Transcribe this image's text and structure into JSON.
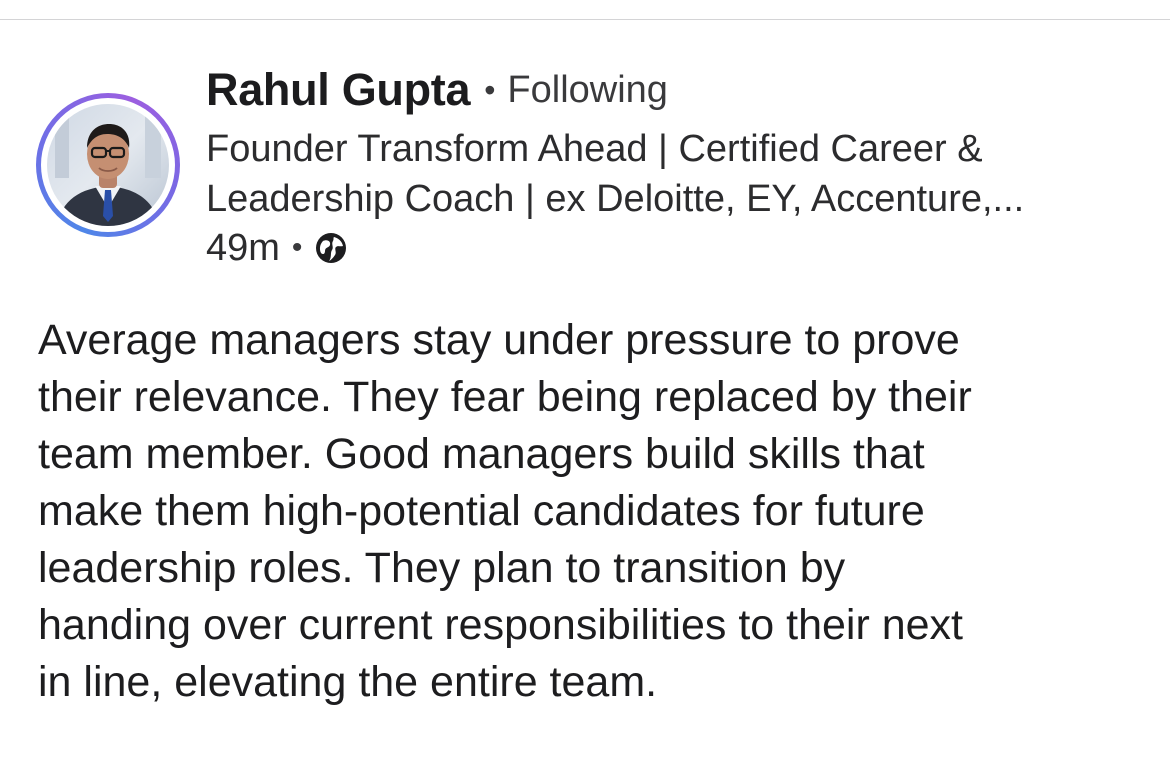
{
  "author": {
    "name": "Rahul Gupta",
    "separator": "•",
    "follow_status": "Following",
    "headline_lines": [
      "Founder Transform Ahead | Certified Career &",
      "Leadership Coach | ex Deloitte, EY, Accenture,..."
    ],
    "avatar_icon": "profile-photo",
    "avatar_ring_color": "#6f6ee6"
  },
  "meta": {
    "timestamp": "49m",
    "separator": "•",
    "visibility_icon": "globe-icon"
  },
  "post": {
    "lines": [
      "Average managers stay under pressure to prove",
      "their relevance. They fear being replaced by their",
      "team member. Good managers build skills that",
      "make them high-potential candidates for future",
      "leadership roles. They plan to transition by",
      "handing over current responsibilities to their next",
      "in line, elevating the entire team."
    ]
  }
}
